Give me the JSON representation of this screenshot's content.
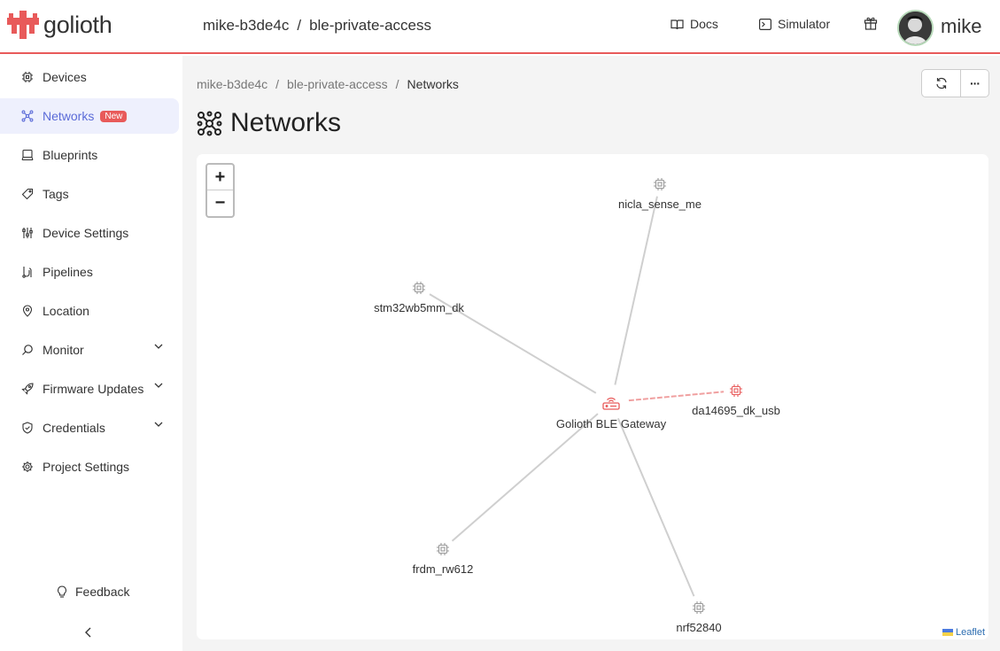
{
  "header": {
    "logo_text": "golioth",
    "project_org": "mike-b3de4c",
    "project_sep": "/",
    "project_name": "ble-private-access",
    "docs_label": "Docs",
    "simulator_label": "Simulator",
    "user_name": "mike"
  },
  "sidebar": {
    "items": [
      {
        "label": "Devices",
        "icon": "chip-icon"
      },
      {
        "label": "Networks",
        "icon": "network-icon",
        "badge": "New"
      },
      {
        "label": "Blueprints",
        "icon": "blueprint-icon"
      },
      {
        "label": "Tags",
        "icon": "tag-icon"
      },
      {
        "label": "Device Settings",
        "icon": "sliders-icon"
      },
      {
        "label": "Pipelines",
        "icon": "pipeline-icon"
      },
      {
        "label": "Location",
        "icon": "location-pin-icon"
      },
      {
        "label": "Monitor",
        "icon": "monitor-icon"
      },
      {
        "label": "Firmware Updates",
        "icon": "rocket-icon"
      },
      {
        "label": "Credentials",
        "icon": "shield-icon"
      },
      {
        "label": "Project Settings",
        "icon": "gear-icon"
      }
    ],
    "feedback_label": "Feedback"
  },
  "main": {
    "breadcrumb": [
      "mike-b3de4c",
      "ble-private-access",
      "Networks"
    ],
    "breadcrumb_sep": "/",
    "title": "Networks",
    "more_label": "···"
  },
  "map": {
    "zoom_in": "+",
    "zoom_out": "−",
    "attribution": "Leaflet",
    "gateway": {
      "name": "Golioth BLE Gateway",
      "color": "#e85a5a"
    },
    "nodes": [
      {
        "name": "nicla_sense_me",
        "active": false
      },
      {
        "name": "stm32wb5mm_dk",
        "active": false
      },
      {
        "name": "da14695_dk_usb",
        "active": true
      },
      {
        "name": "frdm_rw612",
        "active": false
      },
      {
        "name": "nrf52840",
        "active": false
      }
    ]
  }
}
